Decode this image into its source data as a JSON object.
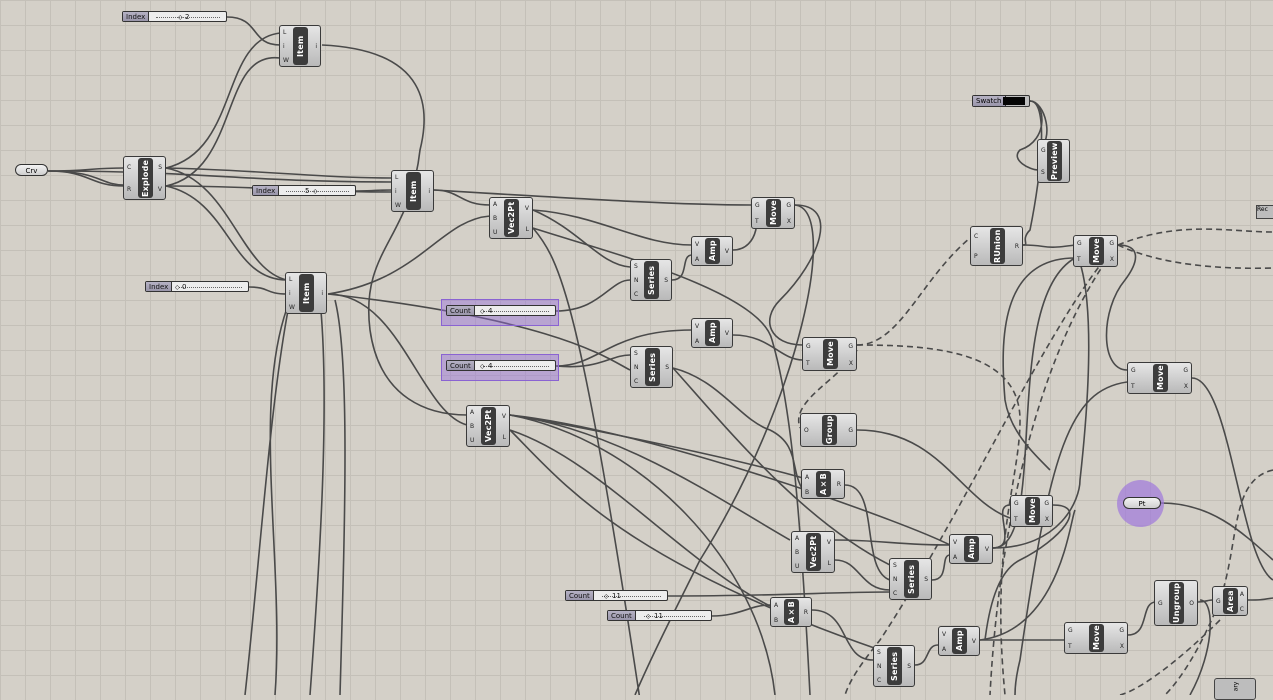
{
  "canvas": {
    "background": "#d4d0c8",
    "grid_color": "#c4c0b8",
    "wire_color": "#4a4a4a"
  },
  "params": {
    "crv": "Crv",
    "pt": "Pt"
  },
  "sliders": [
    {
      "id": "s_index2",
      "label": "Index",
      "value": "2"
    },
    {
      "id": "s_index5",
      "label": "Index",
      "value": "5"
    },
    {
      "id": "s_index0",
      "label": "Index",
      "value": "0"
    },
    {
      "id": "s_count1",
      "label": "Count",
      "value": "4"
    },
    {
      "id": "s_count2",
      "label": "Count",
      "value": "4"
    },
    {
      "id": "s_count11a",
      "label": "Count",
      "value": "11"
    },
    {
      "id": "s_count11b",
      "label": "Count",
      "value": "11"
    }
  ],
  "swatch": {
    "label": "Swatch",
    "color": "#050505"
  },
  "components": [
    {
      "id": "item1",
      "nick": "Item",
      "inputs": [
        "L",
        "i",
        "W"
      ],
      "outputs": [
        "i"
      ]
    },
    {
      "id": "explode",
      "nick": "Explode",
      "inputs": [
        "C",
        "R"
      ],
      "outputs": [
        "S",
        "V"
      ]
    },
    {
      "id": "item2",
      "nick": "Item",
      "inputs": [
        "L",
        "i",
        "W"
      ],
      "outputs": [
        "i"
      ]
    },
    {
      "id": "item3",
      "nick": "Item",
      "inputs": [
        "L",
        "i",
        "W"
      ],
      "outputs": [
        "i"
      ]
    },
    {
      "id": "vec1",
      "nick": "Vec2Pt",
      "inputs": [
        "A",
        "B",
        "U"
      ],
      "outputs": [
        "V",
        "L"
      ]
    },
    {
      "id": "vec2",
      "nick": "Vec2Pt",
      "inputs": [
        "A",
        "B",
        "U"
      ],
      "outputs": [
        "V",
        "L"
      ]
    },
    {
      "id": "vec3",
      "nick": "Vec2Pt",
      "inputs": [
        "A",
        "B",
        "U"
      ],
      "outputs": [
        "V",
        "L"
      ]
    },
    {
      "id": "move1",
      "nick": "Move",
      "inputs": [
        "G",
        "T"
      ],
      "outputs": [
        "G",
        "X"
      ]
    },
    {
      "id": "amp1",
      "nick": "Amp",
      "inputs": [
        "V",
        "A"
      ],
      "outputs": [
        "V"
      ]
    },
    {
      "id": "amp2",
      "nick": "Amp",
      "inputs": [
        "V",
        "A"
      ],
      "outputs": [
        "V"
      ]
    },
    {
      "id": "amp3",
      "nick": "Amp",
      "inputs": [
        "V",
        "A"
      ],
      "outputs": [
        "V"
      ]
    },
    {
      "id": "amp4",
      "nick": "Amp",
      "inputs": [
        "V",
        "A"
      ],
      "outputs": [
        "V"
      ]
    },
    {
      "id": "series1",
      "nick": "Series",
      "inputs": [
        "S",
        "N",
        "C"
      ],
      "outputs": [
        "S"
      ]
    },
    {
      "id": "series2",
      "nick": "Series",
      "inputs": [
        "S",
        "N",
        "C"
      ],
      "outputs": [
        "S"
      ]
    },
    {
      "id": "series3",
      "nick": "Series",
      "inputs": [
        "S",
        "N",
        "C"
      ],
      "outputs": [
        "S"
      ]
    },
    {
      "id": "series4",
      "nick": "Series",
      "inputs": [
        "S",
        "N",
        "C"
      ],
      "outputs": [
        "S"
      ]
    },
    {
      "id": "move2",
      "nick": "Move",
      "inputs": [
        "G",
        "T"
      ],
      "outputs": [
        "G",
        "X"
      ]
    },
    {
      "id": "group",
      "nick": "Group",
      "inputs": [
        "O"
      ],
      "outputs": [
        "G"
      ]
    },
    {
      "id": "axb1",
      "nick": "A×B",
      "inputs": [
        "A",
        "B"
      ],
      "outputs": [
        "R"
      ]
    },
    {
      "id": "axb2",
      "nick": "A×B",
      "inputs": [
        "A",
        "B"
      ],
      "outputs": [
        "R"
      ]
    },
    {
      "id": "preview",
      "nick": "Preview",
      "inputs": [
        "G",
        "S"
      ],
      "outputs": []
    },
    {
      "id": "runion",
      "nick": "RUnion",
      "inputs": [
        "C",
        "P"
      ],
      "outputs": [
        "R"
      ]
    },
    {
      "id": "move3",
      "nick": "Move",
      "inputs": [
        "G",
        "T"
      ],
      "outputs": [
        "G",
        "X"
      ]
    },
    {
      "id": "move4",
      "nick": "Move",
      "inputs": [
        "G",
        "T"
      ],
      "outputs": [
        "G",
        "X"
      ]
    },
    {
      "id": "move5",
      "nick": "Move",
      "inputs": [
        "G",
        "T"
      ],
      "outputs": [
        "G",
        "X"
      ]
    },
    {
      "id": "move6",
      "nick": "Move",
      "inputs": [
        "G",
        "T"
      ],
      "outputs": [
        "G",
        "X"
      ]
    },
    {
      "id": "ungroup",
      "nick": "Ungroup",
      "inputs": [
        "G"
      ],
      "outputs": [
        "O"
      ]
    },
    {
      "id": "area",
      "nick": "Area",
      "inputs": [
        "G"
      ],
      "outputs": [
        "A",
        "C"
      ]
    }
  ],
  "edge_labels": {
    "top_right": "Rec",
    "bottom_right": "ary"
  }
}
